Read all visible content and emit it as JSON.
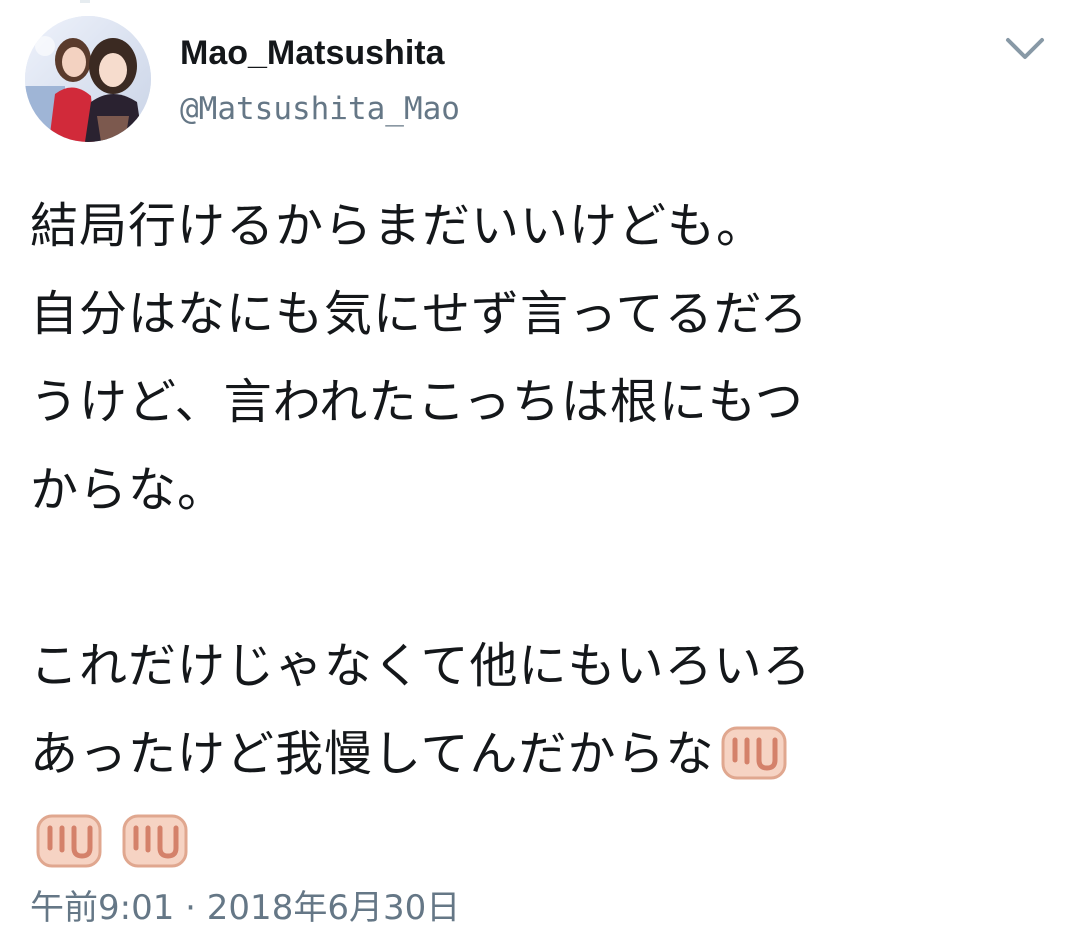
{
  "user": {
    "display_name": "Mao_Matsushita",
    "handle": "@Matsushita_Mao",
    "avatar_icon": "profile-photo"
  },
  "menu": {
    "icon": "chevron-down-icon"
  },
  "tweet": {
    "lines_1": [
      "結局行けるからまだいいけども。",
      "自分はなにも気にせず言ってるだろ",
      "うけど、言われたこっちは根にもつ",
      "からな。"
    ],
    "lines_2": [
      "これだけじゃなくて他にもいろいろ",
      "あったけど我慢してんだからな"
    ],
    "emoji_icon": "oncoming-fist-icon",
    "trailing_fist_count": 2
  },
  "meta": {
    "time": "午前9:01",
    "separator": "·",
    "date": "2018年6月30日"
  },
  "colors": {
    "text": "#14171a",
    "secondary": "#657786",
    "fist_skin": "#f6d3c3",
    "fist_outline": "#e0a78f"
  }
}
